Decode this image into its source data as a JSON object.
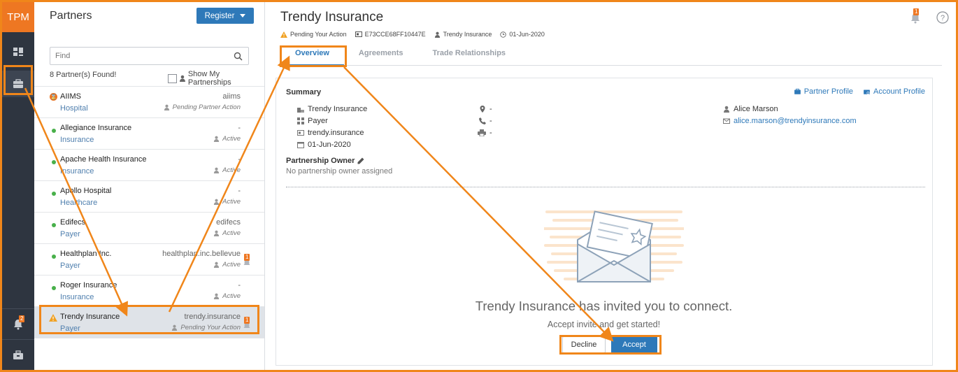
{
  "rail": {
    "logo": "TPM",
    "notif_count": "2"
  },
  "partners": {
    "title": "Partners",
    "register_label": "Register",
    "search_placeholder": "Find",
    "found_text": "8 Partner(s) Found!",
    "show_my_label": "Show My Partnerships",
    "items": [
      {
        "name": "AIIMS",
        "type": "Hospital",
        "domain": "aiims",
        "status": "Pending Partner Action",
        "indicator": "pending-partner",
        "bell": ""
      },
      {
        "name": "Allegiance Insurance",
        "type": "Insurance",
        "domain": "-",
        "status": "Active",
        "indicator": "active",
        "bell": ""
      },
      {
        "name": "Apache Health Insurance",
        "type": "Insurance",
        "domain": "-",
        "status": "Active",
        "indicator": "active",
        "bell": ""
      },
      {
        "name": "Apollo Hospital",
        "type": "Healthcare",
        "domain": "-",
        "status": "Active",
        "indicator": "active",
        "bell": ""
      },
      {
        "name": "Edifecs",
        "type": "Payer",
        "domain": "edifecs",
        "status": "Active",
        "indicator": "active",
        "bell": ""
      },
      {
        "name": "Healthplan Inc.",
        "type": "Payer",
        "domain": "healthplan.inc.bellevue",
        "status": "Active",
        "indicator": "active",
        "bell": "1"
      },
      {
        "name": "Roger Insurance",
        "type": "Insurance",
        "domain": "-",
        "status": "Active",
        "indicator": "active",
        "bell": ""
      },
      {
        "name": "Trendy Insurance",
        "type": "Payer",
        "domain": "trendy.insurance",
        "status": "Pending Your Action",
        "indicator": "warning",
        "bell": "1"
      }
    ]
  },
  "main": {
    "title": "Trendy Insurance",
    "meta": {
      "status": "Pending Your Action",
      "id": "E73CCE68FF10447E",
      "owner": "Trendy Insurance",
      "date": "01-Jun-2020"
    },
    "header_notif_count": "1",
    "tabs": [
      "Overview",
      "Agreements",
      "Trade Relationships"
    ],
    "summary_title": "Summary",
    "partner_profile_link": "Partner Profile",
    "account_profile_link": "Account Profile",
    "col1": [
      "Trendy Insurance",
      "Payer",
      "trendy.insurance",
      "01-Jun-2020"
    ],
    "col2": [
      "-",
      "-",
      "-"
    ],
    "contact_name": "Alice Marson",
    "contact_email": "alice.marson@trendyinsurance.com",
    "owner_title": "Partnership Owner",
    "owner_sub": "No partnership owner assigned",
    "invite_text": "Trendy Insurance has invited you to connect.",
    "invite_sub": "Accept invite and get started!",
    "decline_label": "Decline",
    "accept_label": "Accept"
  },
  "colors": {
    "accent": "#2e79b9",
    "brand_orange": "#ee7722",
    "highlight": "#f0861a",
    "active_green": "#48b04a",
    "rail_bg": "#2e3540"
  }
}
